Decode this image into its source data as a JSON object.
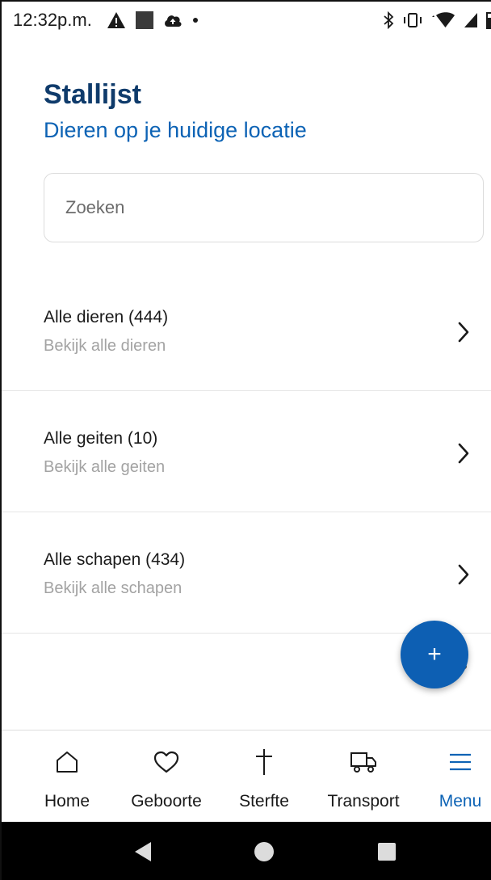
{
  "status_bar": {
    "time": "12:32p.m."
  },
  "header": {
    "title": "Stallijst",
    "subtitle": "Dieren op je huidige locatie"
  },
  "search": {
    "placeholder": "Zoeken",
    "value": ""
  },
  "list": {
    "items": [
      {
        "title": "Alle dieren (444)",
        "subtitle": "Bekijk alle dieren"
      },
      {
        "title": "Alle geiten (10)",
        "subtitle": "Bekijk alle geiten"
      },
      {
        "title": "Alle schapen (434)",
        "subtitle": "Bekijk alle schapen"
      }
    ]
  },
  "fab": {
    "label": "+"
  },
  "bottom_nav": {
    "items": [
      {
        "label": "Home",
        "icon": "home-icon"
      },
      {
        "label": "Geboorte",
        "icon": "heart-icon"
      },
      {
        "label": "Sterfte",
        "icon": "cross-icon"
      },
      {
        "label": "Transport",
        "icon": "truck-icon"
      },
      {
        "label": "Menu",
        "icon": "hamburger-menu-icon"
      }
    ],
    "active": "Menu"
  },
  "colors": {
    "title": "#0f3b6b",
    "accent": "#0d63b5",
    "fab": "#0d5fb3",
    "muted_text": "#a3a3a3"
  }
}
